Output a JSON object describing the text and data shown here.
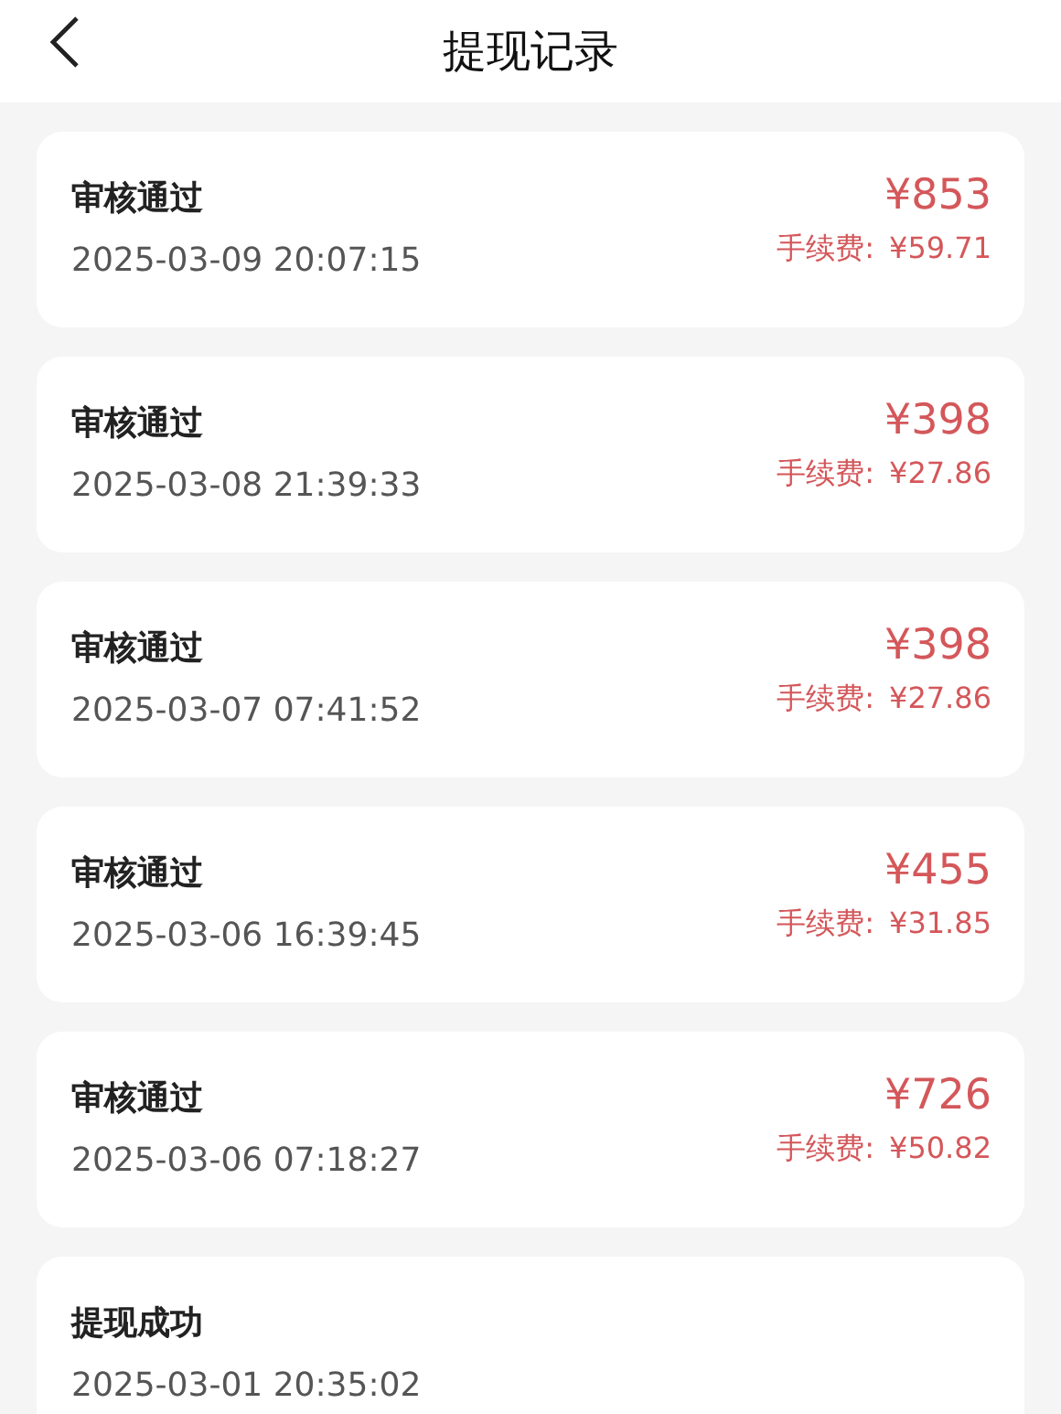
{
  "header": {
    "title": "提现记录"
  },
  "records": [
    {
      "status": "审核通过",
      "time": "2025-03-09 20:07:15",
      "amount": "¥853",
      "fee_label": "手续费:",
      "fee": "¥59.71"
    },
    {
      "status": "审核通过",
      "time": "2025-03-08 21:39:33",
      "amount": "¥398",
      "fee_label": "手续费:",
      "fee": "¥27.86"
    },
    {
      "status": "审核通过",
      "time": "2025-03-07 07:41:52",
      "amount": "¥398",
      "fee_label": "手续费:",
      "fee": "¥27.86"
    },
    {
      "status": "审核通过",
      "time": "2025-03-06 16:39:45",
      "amount": "¥455",
      "fee_label": "手续费:",
      "fee": "¥31.85"
    },
    {
      "status": "审核通过",
      "time": "2025-03-06 07:18:27",
      "amount": "¥726",
      "fee_label": "手续费:",
      "fee": "¥50.82"
    },
    {
      "status": "提现成功",
      "time": "2025-03-01 20:35:02"
    }
  ]
}
